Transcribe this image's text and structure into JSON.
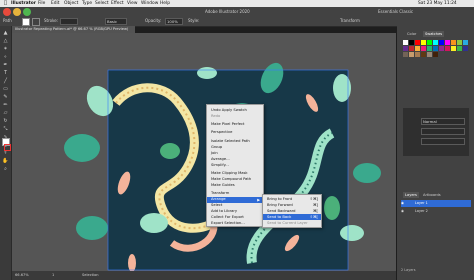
{
  "menubar": {
    "apple": "",
    "app": "Illustrator",
    "items": [
      "File",
      "Edit",
      "Object",
      "Type",
      "Select",
      "Effect",
      "View",
      "Window",
      "Help"
    ],
    "clock": "Sat 23 May  11:24"
  },
  "window_title": "Adobe Illustrator 2020",
  "control_bar": {
    "path_label": "Path",
    "stroke_label": "Stroke:",
    "style_value": "Basic",
    "opacity_label": "Opacity:",
    "opacity_value": "100%",
    "style_label": "Style:",
    "transform_label": "Transform",
    "workspace": "Essentials Classic"
  },
  "document_tab": "Illustrator Repeating Pattern.ai* @ 66.67 % (RGB/GPU Preview)",
  "status": {
    "zoom": "66.67%",
    "page": "1",
    "mode": "Selection"
  },
  "context_menu": {
    "items": [
      {
        "label": "Undo Apply Swatch",
        "enabled": true
      },
      {
        "label": "Redo",
        "enabled": false
      },
      {
        "label": "Make Pixel Perfect",
        "enabled": true
      },
      {
        "label": "Perspective",
        "enabled": true
      },
      {
        "label": "Isolate Selected Path",
        "enabled": true
      },
      {
        "label": "Group",
        "enabled": true
      },
      {
        "label": "Join",
        "enabled": true
      },
      {
        "label": "Average...",
        "enabled": true
      },
      {
        "label": "Simplify...",
        "enabled": true
      },
      {
        "label": "Make Clipping Mask",
        "enabled": true
      },
      {
        "label": "Make Compound Path",
        "enabled": true
      },
      {
        "label": "Make Guides",
        "enabled": true
      },
      {
        "label": "Transform",
        "enabled": true
      },
      {
        "label": "Arrange",
        "enabled": true
      },
      {
        "label": "Select",
        "enabled": true
      },
      {
        "label": "Add to Library",
        "enabled": true
      },
      {
        "label": "Collect For Export",
        "enabled": true
      },
      {
        "label": "Export Selection...",
        "enabled": true
      }
    ]
  },
  "arrange_submenu": {
    "items": [
      {
        "label": "Bring to Front",
        "shortcut": "⇧⌘]"
      },
      {
        "label": "Bring Forward",
        "shortcut": "⌘]"
      },
      {
        "label": "Send Backward",
        "shortcut": "⌘["
      },
      {
        "label": "Send to Back",
        "shortcut": "⇧⌘["
      },
      {
        "label": "Send to Current Layer",
        "shortcut": ""
      }
    ]
  },
  "right_panel": {
    "tabs": [
      "Color",
      "Swatches"
    ],
    "props_label": "Normal",
    "layers_tabs": [
      "Layers",
      "Artboards"
    ],
    "layers": [
      "Layer 1",
      "Layer 2"
    ],
    "layers_count": "2 Layers"
  },
  "swatch_colors": [
    "#ffffff",
    "#000000",
    "#ff0000",
    "#ffff00",
    "#00ff00",
    "#00ffff",
    "#0000ff",
    "#ff00ff",
    "#f7931e",
    "#8cc63f",
    "#29abe2",
    "#662d91",
    "#c1272d",
    "#fbb03b",
    "#ed1e79",
    "#22b573",
    "#0071bc",
    "#93278f",
    "#d4145a",
    "#fcee21",
    "#39b54a",
    "#2e3192",
    "#736357",
    "#c69c6d",
    "#a67c52",
    "#603813",
    "#998675",
    "#42210b"
  ],
  "colors": {
    "pattern_bg": "#173848",
    "leaf_teal": "#3aa98d",
    "leaf_light": "#9fe3c8",
    "snake_yellow": "#f3e6a4",
    "leaf_pink": "#f4b39a",
    "leaf_green": "#4bb07a"
  }
}
